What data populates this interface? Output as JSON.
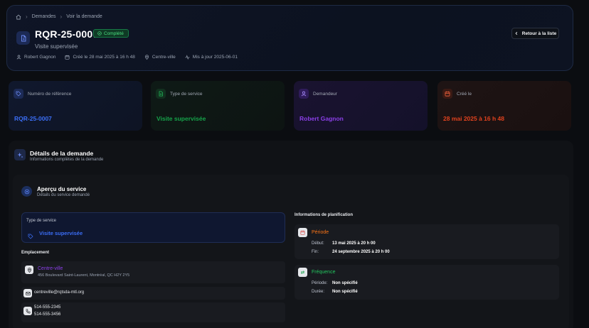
{
  "breadcrumb": {
    "parent": "Demandes",
    "current": "Voir la demande"
  },
  "header": {
    "request_id": "RQR-25-0007",
    "status": "Complété",
    "subtitle": "Visite supervisée",
    "meta": {
      "author": "Robert Gagnon",
      "created": "Créé le 28 mai 2025 à 16 h 48",
      "location": "Centre-ville",
      "updated": "Mis à jour 2025-06-01"
    },
    "back_label": "Retour à la liste"
  },
  "info_cards": {
    "reference": {
      "label": "Numéro de référence",
      "value": "RQR-25-0007",
      "color": "#3b6ef6"
    },
    "service": {
      "label": "Type de service",
      "value": "Visite supervisée",
      "color": "#16a34a"
    },
    "requester": {
      "label": "Demandeur",
      "value": "Robert Gagnon",
      "color": "#8b3fe8"
    },
    "created": {
      "label": "Créé le",
      "value": "28 mai 2025 à 16 h 48",
      "color": "#e0421e"
    }
  },
  "details": {
    "title": "Détails de la demande",
    "subtitle": "Informations complètes de la demande"
  },
  "overview": {
    "title": "Aperçu du service",
    "subtitle": "Détails du service demandé",
    "service_type_label": "Type de service",
    "service_type_value": "Visite supervisée",
    "location_heading": "Emplacement",
    "location_name": "Centre-ville",
    "location_address": "456 Boulevard Saint-Laurent, Montréal, QC H2Y 2Y5",
    "email": "centreville@rqtsda-mtl.org",
    "phone_1": "514-555-2345",
    "phone_2": "514-555-3456"
  },
  "planning": {
    "heading": "Informations de planification",
    "period": {
      "title": "Période",
      "start_label": "Début:",
      "start_value": "13 mai 2025 à 20 h 00",
      "end_label": "Fin:",
      "end_value": "24 septembre 2025 à 20 h 00"
    },
    "frequency": {
      "title": "Fréquence",
      "period_label": "Période:",
      "period_value": "Non spécifié",
      "duration_label": "Durée:",
      "duration_value": "Non spécifié"
    }
  }
}
